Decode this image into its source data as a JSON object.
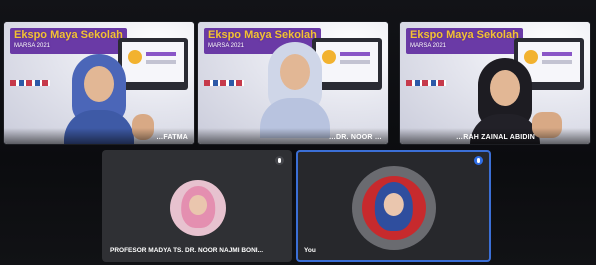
{
  "tiles": [
    {
      "name": "…FATMA",
      "slide_title": "Ekspo Maya Sekolah",
      "slide_sub": "MARSA 2021"
    },
    {
      "name": "…DR. NOOR …",
      "slide_title": "Ekspo Maya Sekolah",
      "slide_sub": "MARSA 2021"
    },
    {
      "name": "…RAH ZAINAL ABIDIN",
      "slide_title": "Ekspo Maya Sekolah",
      "slide_sub": "MARSA 2021"
    }
  ],
  "bottom": [
    {
      "name": "PROFESOR MADYA TS. DR. NOOR NAJMI BONI..."
    },
    {
      "name": "You"
    }
  ],
  "colors": {
    "active_border": "#3b6fd6",
    "slide_purple": "#6a3aa6",
    "title_gold": "#f3c233"
  }
}
